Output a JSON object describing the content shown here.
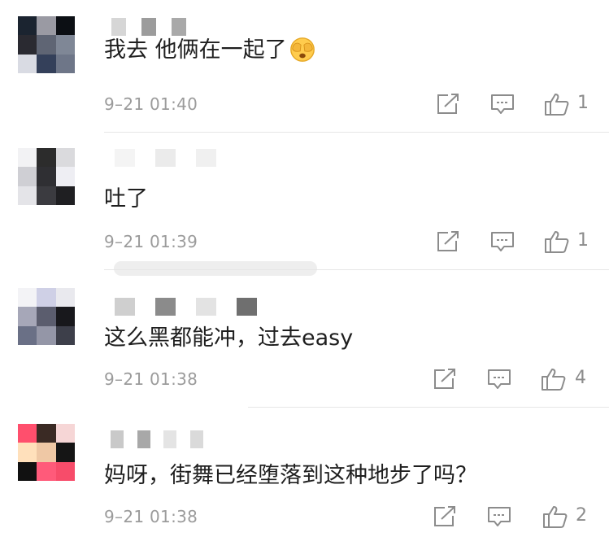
{
  "comments": [
    {
      "text": "我去 他俩在一起了",
      "emoji": "see-no-evil-face-emoji",
      "time": "9–21 01:40",
      "likes": "1",
      "avatar_colors": [
        "#1b2430",
        "#9a9aa3",
        "#0c0f14",
        "#2a2a31",
        "#5f6574",
        "#7f8796",
        "#d9dbe3",
        "#34405a",
        "#6e7688"
      ],
      "name_blur_colors": [
        "#d6d6d6",
        "#9c9c9c",
        "#a9a9a9"
      ]
    },
    {
      "text": "吐了",
      "time": "9–21 01:39",
      "likes": "1",
      "avatar_colors": [
        "#f2f2f4",
        "#2c2c2c",
        "#dadadd",
        "#cfcfd4",
        "#2f2f33",
        "#eeeef3",
        "#e4e4e8",
        "#3b3b40",
        "#1f1f22"
      ],
      "name_blur_colors": [
        "#f4f4f4",
        "#ebebeb",
        "#f0f0f0"
      ]
    },
    {
      "text": "这么黑都能冲，过去easy",
      "time": "9–21 01:38",
      "likes": "4",
      "avatar_colors": [
        "#f3f3f6",
        "#cfd0e6",
        "#e9e9ee",
        "#a6a7b8",
        "#5b5d6e",
        "#18181c",
        "#6a7086",
        "#9496a7",
        "#3d3f4a"
      ],
      "name_blur_colors": [
        "#cfcfcf",
        "#8b8b8b",
        "#e3e3e3",
        "#6f6f6f"
      ]
    },
    {
      "text": "妈呀，街舞已经堕落到这种地步了吗？",
      "time": "9–21 01:38",
      "likes": "2",
      "avatar_colors": [
        "#ff4f6d",
        "#3a2a24",
        "#f6d6d6",
        "#ffe0bb",
        "#efc8a5",
        "#151515",
        "#111111",
        "#ff5a7a",
        "#f74c6a"
      ],
      "name_blur_colors": [
        "#c9c9c9",
        "#a8a8a8",
        "#e4e4e4",
        "#dadada"
      ]
    }
  ],
  "actions": {
    "forward_icon": "share-square-icon",
    "comment_icon": "comment-bubble-icon",
    "like_icon": "thumbs-up-icon"
  },
  "colors": {
    "timestamp": "#9b9b9b",
    "icon": "#8c8c8c",
    "divider": "#e6e6e6"
  }
}
